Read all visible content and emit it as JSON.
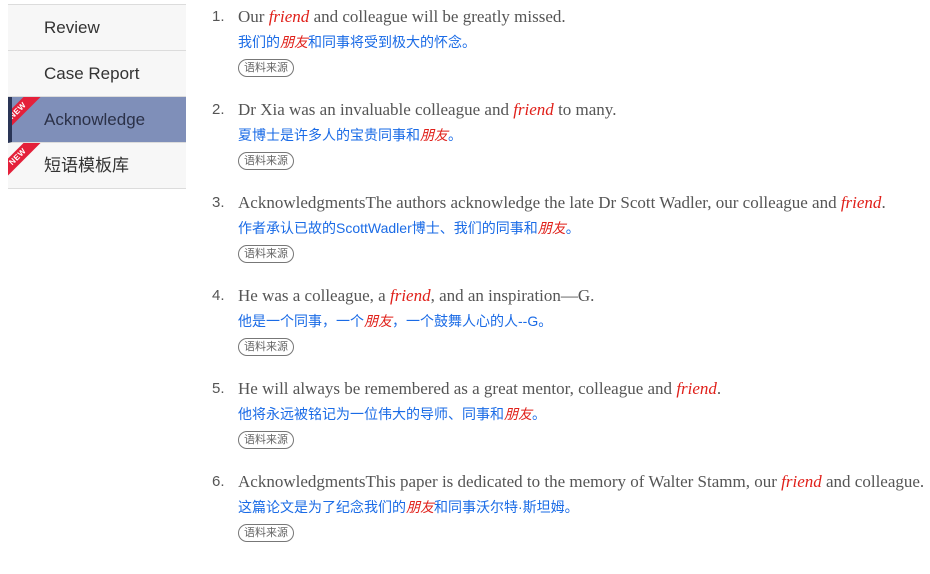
{
  "sidebar": {
    "items": [
      {
        "label": "Review",
        "active": false,
        "new": false
      },
      {
        "label": "Case Report",
        "active": false,
        "new": false
      },
      {
        "label": "Acknowledge",
        "active": true,
        "new": true
      },
      {
        "label": "短语模板库",
        "active": false,
        "new": true
      }
    ],
    "new_badge": "NEW"
  },
  "keyword_en": "friend",
  "keyword_zh": "朋友",
  "source_label": "语料来源",
  "entries": [
    {
      "num": "1.",
      "en_pre": "Our ",
      "en_post": " and colleague will be greatly missed.",
      "zh_pre": "我们的",
      "zh_post": "和同事将受到极大的怀念。"
    },
    {
      "num": "2.",
      "en_pre": "Dr Xia was an invaluable colleague and ",
      "en_post": " to many.",
      "zh_pre": "夏博士是许多人的宝贵同事和",
      "zh_post": "。"
    },
    {
      "num": "3.",
      "en_pre": "AcknowledgmentsThe authors acknowledge the late Dr Scott Wadler, our colleague and ",
      "en_post": ".",
      "zh_pre": "作者承认已故的ScottWadler博士、我们的同事和",
      "zh_post": "。"
    },
    {
      "num": "4.",
      "en_pre": "He was a colleague, a ",
      "en_post": ", and an inspiration—G.",
      "zh_pre": "他是一个同事，一个",
      "zh_post": "，一个鼓舞人心的人--G。"
    },
    {
      "num": "5.",
      "en_pre": "He will always be remembered as a great mentor, colleague and ",
      "en_post": ".",
      "zh_pre": "他将永远被铭记为一位伟大的导师、同事和",
      "zh_post": "。"
    },
    {
      "num": "6.",
      "en_pre": "AcknowledgmentsThis paper is dedicated to the memory of Walter Stamm, our ",
      "en_post": " and colleague.",
      "zh_pre": "这篇论文是为了纪念我们的",
      "zh_post": "和同事沃尔特·斯坦姆。"
    }
  ]
}
